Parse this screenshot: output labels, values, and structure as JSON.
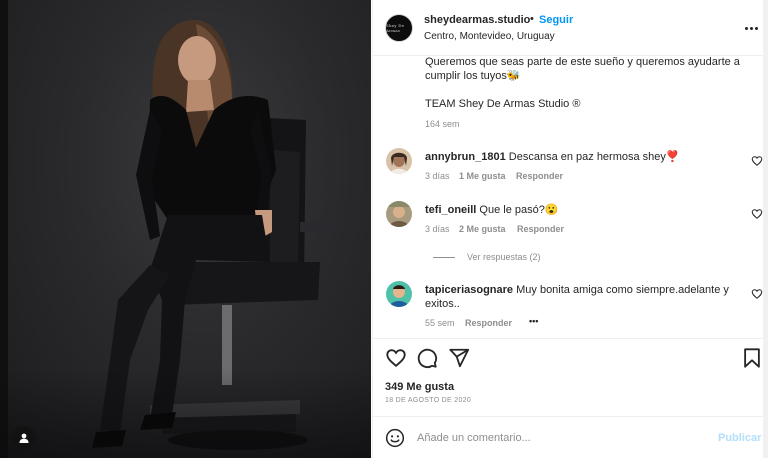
{
  "post": {
    "username": "sheydearmas.studio",
    "separator": "•",
    "follow_label": "Seguir",
    "location": "Centro, Montevideo, Uruguay",
    "avatar_logo_text": "Shey De Armas"
  },
  "caption": {
    "line1": "Queremos que seas parte de este sueño y queremos ayudarte a",
    "line2": "cumplir los tuyos🐝",
    "signature": "TEAM Shey De Armas Studio ®",
    "age": "164 sem"
  },
  "comments": [
    {
      "username": "annybrun_1801",
      "text": "Descansa en paz hermosa shey❣️",
      "time": "3 días",
      "likes": "1 Me gusta",
      "reply": "Responder"
    },
    {
      "username": "tefi_oneill",
      "text": "Que le pasó?😮",
      "time": "3 días",
      "likes": "2 Me gusta",
      "reply": "Responder",
      "view_replies": "Ver respuestas (2)"
    },
    {
      "username": "tapiceriasognare",
      "text_line1": "Muy bonita amiga como siempre.adelante y",
      "text_line2": "exitos..",
      "time": "55 sem",
      "reply": "Responder",
      "more": "•••"
    }
  ],
  "stats": {
    "likes": "349 Me gusta",
    "date": "18 DE AGOSTO DE 2020"
  },
  "composer": {
    "placeholder": "Añade un comentario...",
    "publish_label": "Publicar"
  },
  "icons": {
    "like": "heart-icon",
    "comment": "comment-icon",
    "share": "share-icon",
    "save": "bookmark-icon",
    "emoji": "emoji-icon",
    "more": "more-icon",
    "tag": "user-tag-icon"
  },
  "colors": {
    "accent": "#0095f6",
    "text": "#262626",
    "muted": "#8e8e8e",
    "publish_disabled": "#b2dffc"
  }
}
